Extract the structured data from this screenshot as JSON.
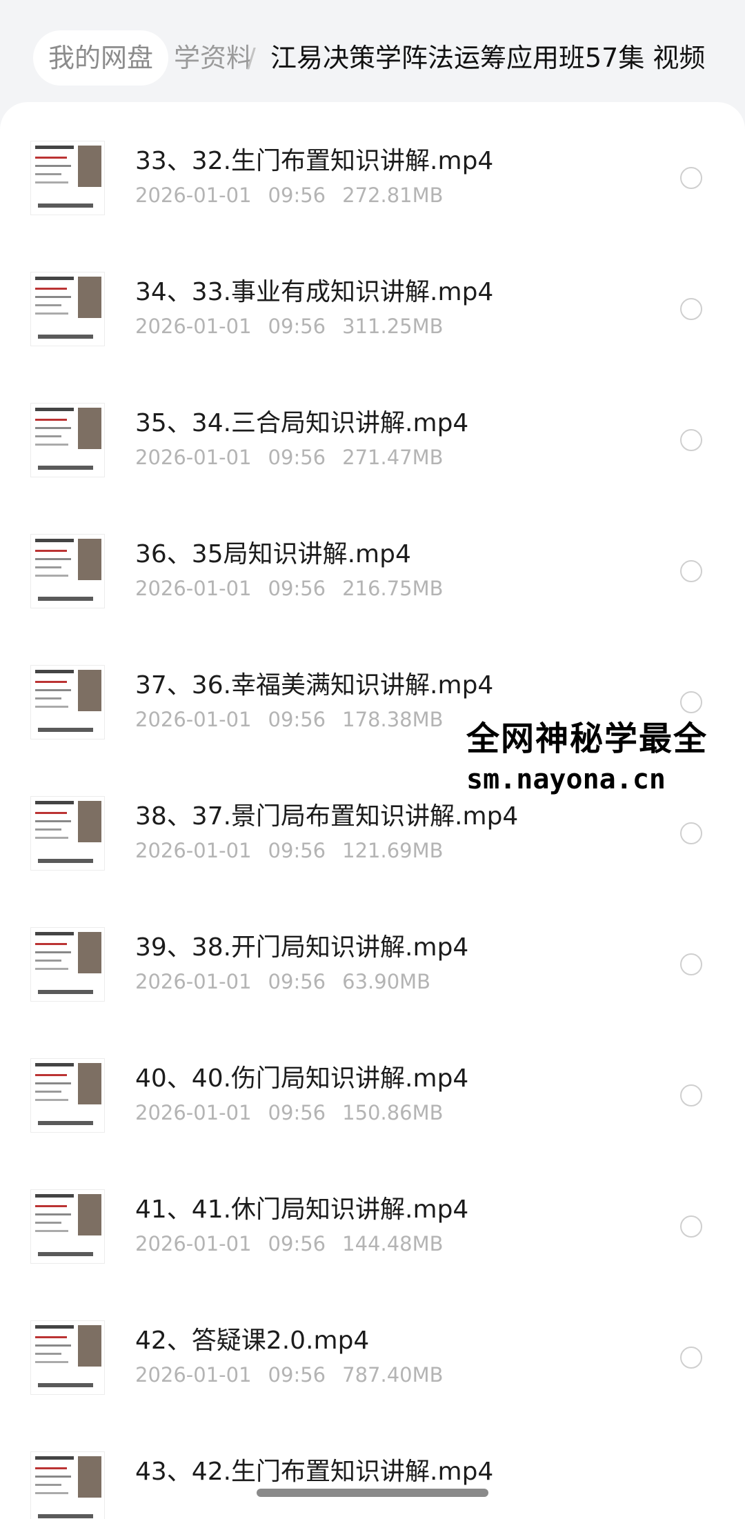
{
  "breadcrumb": {
    "root": "我的网盘",
    "middle": "学资料",
    "separator": "/",
    "current": "江易决策学阵法运筹应用班57集 视频"
  },
  "files": [
    {
      "name": "33、32.生门布置知识讲解.mp4",
      "date": "2026-01-01",
      "time": "09:56",
      "size": "272.81MB"
    },
    {
      "name": "34、33.事业有成知识讲解.mp4",
      "date": "2026-01-01",
      "time": "09:56",
      "size": "311.25MB"
    },
    {
      "name": "35、34.三合局知识讲解.mp4",
      "date": "2026-01-01",
      "time": "09:56",
      "size": "271.47MB"
    },
    {
      "name": "36、35局知识讲解.mp4",
      "date": "2026-01-01",
      "time": "09:56",
      "size": "216.75MB"
    },
    {
      "name": "37、36.幸福美满知识讲解.mp4",
      "date": "2026-01-01",
      "time": "09:56",
      "size": "178.38MB"
    },
    {
      "name": "38、37.景门局布置知识讲解.mp4",
      "date": "2026-01-01",
      "time": "09:56",
      "size": "121.69MB"
    },
    {
      "name": "39、38.开门局知识讲解.mp4",
      "date": "2026-01-01",
      "time": "09:56",
      "size": "63.90MB"
    },
    {
      "name": "40、40.伤门局知识讲解.mp4",
      "date": "2026-01-01",
      "time": "09:56",
      "size": "150.86MB"
    },
    {
      "name": "41、41.休门局知识讲解.mp4",
      "date": "2026-01-01",
      "time": "09:56",
      "size": "144.48MB"
    },
    {
      "name": "42、答疑课2.0.mp4",
      "date": "2026-01-01",
      "time": "09:56",
      "size": "787.40MB"
    },
    {
      "name": "43、42.生门布置知识讲解.mp4",
      "date": "",
      "time": "",
      "size": ""
    }
  ],
  "watermark": {
    "line1": "全网神秘学最全",
    "line2": "sm.nayona.cn"
  },
  "icons": {
    "thumbnail": "video-thumbnail-icon",
    "select": "radio-circle-icon"
  }
}
